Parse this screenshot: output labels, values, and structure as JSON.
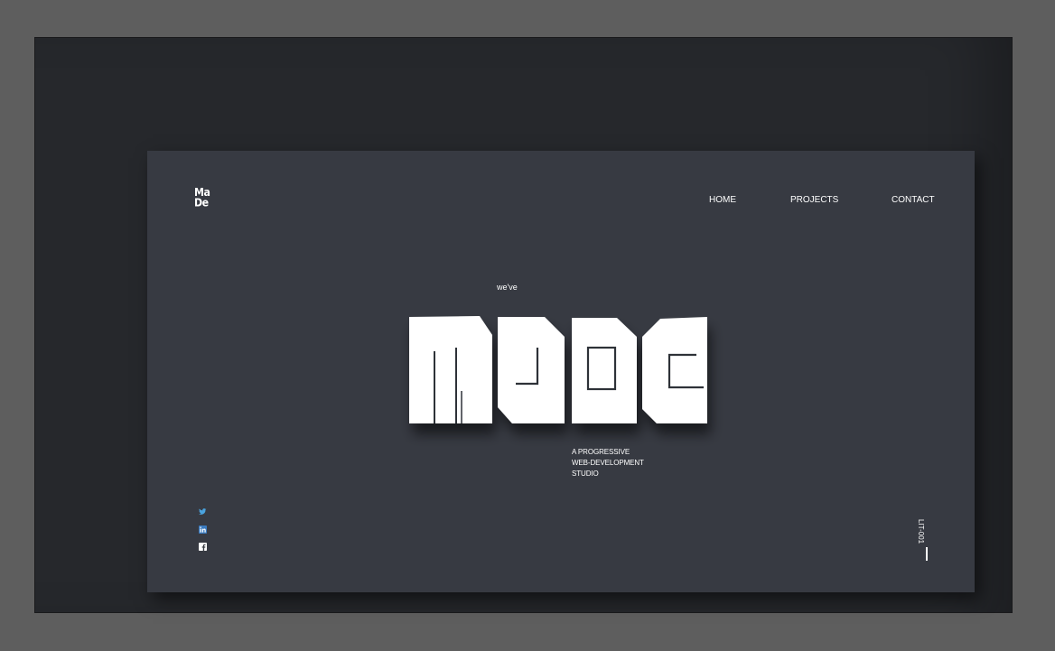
{
  "logo": {
    "line1": "Ma",
    "line2": "De"
  },
  "nav": {
    "items": [
      {
        "label": "HOME"
      },
      {
        "label": "PROJECTS"
      },
      {
        "label": "CONTACT"
      }
    ]
  },
  "hero": {
    "prefix": "we've",
    "wordmark": "made",
    "tagline": [
      "A PROGRESSIVE",
      "WEB-DEVELOPMENT",
      "STUDIO"
    ]
  },
  "social": {
    "icons": [
      "twitter-icon",
      "linkedin-icon",
      "facebook-icon"
    ]
  },
  "footer": {
    "version": "LIT-001"
  },
  "colors": {
    "page_background": "#5e5e5e",
    "frame_background": "#26282c",
    "card_background": "#373a42",
    "text": "#ffffff",
    "accent": "#4aa3df"
  }
}
